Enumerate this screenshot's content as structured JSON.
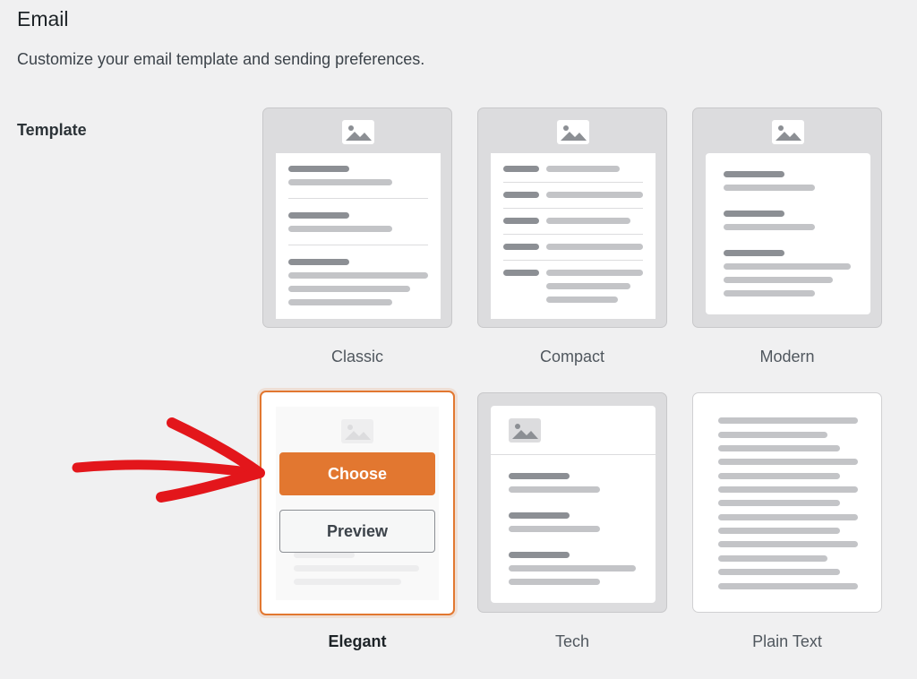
{
  "header": {
    "title": "Email",
    "description": "Customize your email template and sending preferences."
  },
  "template_section": {
    "label": "Template",
    "selected": "Elegant",
    "options": [
      {
        "label": "Classic"
      },
      {
        "label": "Compact"
      },
      {
        "label": "Modern"
      },
      {
        "label": "Elegant"
      },
      {
        "label": "Tech"
      },
      {
        "label": "Plain Text"
      }
    ],
    "hover_actions": {
      "choose_label": "Choose",
      "preview_label": "Preview"
    }
  },
  "colors": {
    "accent": "#e27730",
    "background": "#f0f0f1",
    "annotation_arrow": "#e3161b"
  },
  "icons": [
    "image-placeholder-icon",
    "arrow-annotation"
  ]
}
